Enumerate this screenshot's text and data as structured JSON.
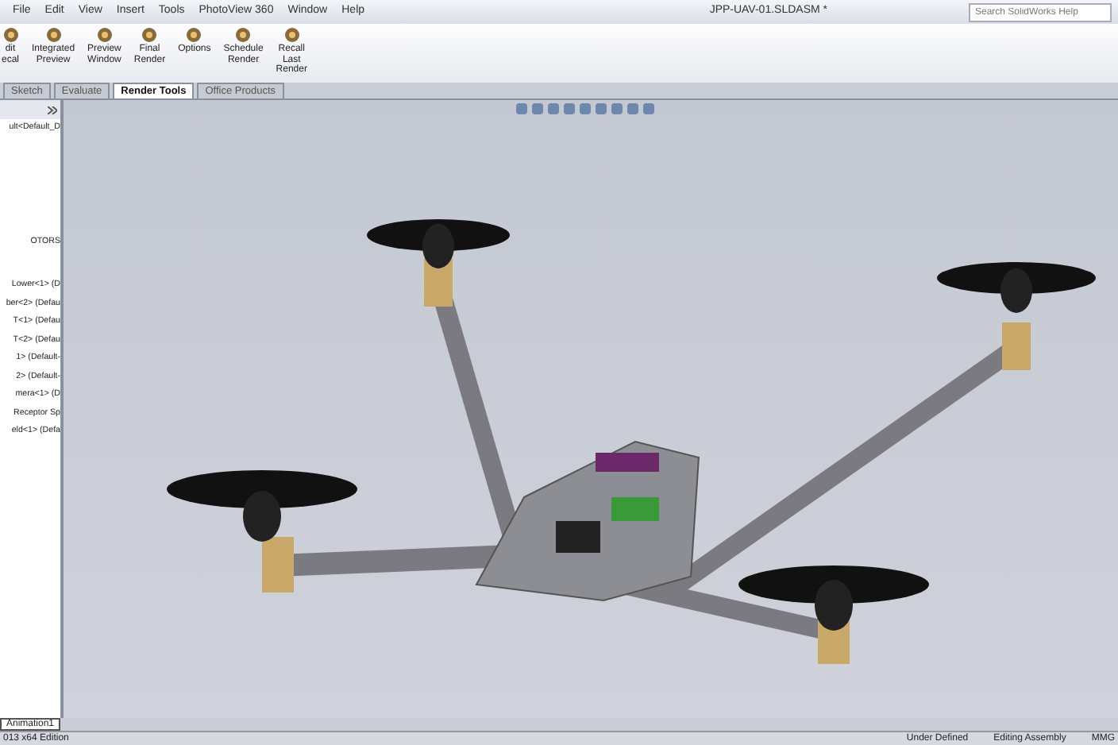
{
  "menu_bar": {
    "items": [
      "File",
      "Edit",
      "View",
      "Insert",
      "Tools",
      "PhotoView 360",
      "Window",
      "Help"
    ],
    "title": "JPP-UAV-01.SLDASM *",
    "search": {
      "placeholder": "Search SolidWorks Help"
    }
  },
  "ribbon": {
    "buttons": [
      {
        "label": "dit\necal"
      },
      {
        "label": "Integrated\nPreview"
      },
      {
        "label": "Preview\nWindow"
      },
      {
        "label": "Final\nRender"
      },
      {
        "label": "Options"
      },
      {
        "label": "Schedule\nRender"
      },
      {
        "label": "Recall\nLast\nRender"
      }
    ]
  },
  "tabs": [
    {
      "label": "Sketch",
      "selected": false
    },
    {
      "label": "Evaluate",
      "selected": false
    },
    {
      "label": "Render Tools",
      "selected": true
    },
    {
      "label": "Office Products",
      "selected": false
    }
  ],
  "sidebar": {
    "items": [
      {
        "label": "ult<Default_D"
      },
      {
        "label": "OTORS"
      },
      {
        "label": "Lower<1> (D"
      },
      {
        "label": "ber<2> (Defau"
      },
      {
        "label": "T<1> (Defau"
      },
      {
        "label": "T<2> (Defau"
      },
      {
        "label": "1> (Default-"
      },
      {
        "label": "2> (Default-"
      },
      {
        "label": "mera<1> (D"
      },
      {
        "label": "Receptor Sp"
      },
      {
        "label": "eld<1> (Defa"
      }
    ]
  },
  "bottom_tabs": [
    {
      "label": "Animation1",
      "selected": true
    }
  ],
  "status_bar": {
    "edition": "013 x64 Edition",
    "state": "Under Defined",
    "mode": "Editing Assembly",
    "units": "MMG"
  }
}
